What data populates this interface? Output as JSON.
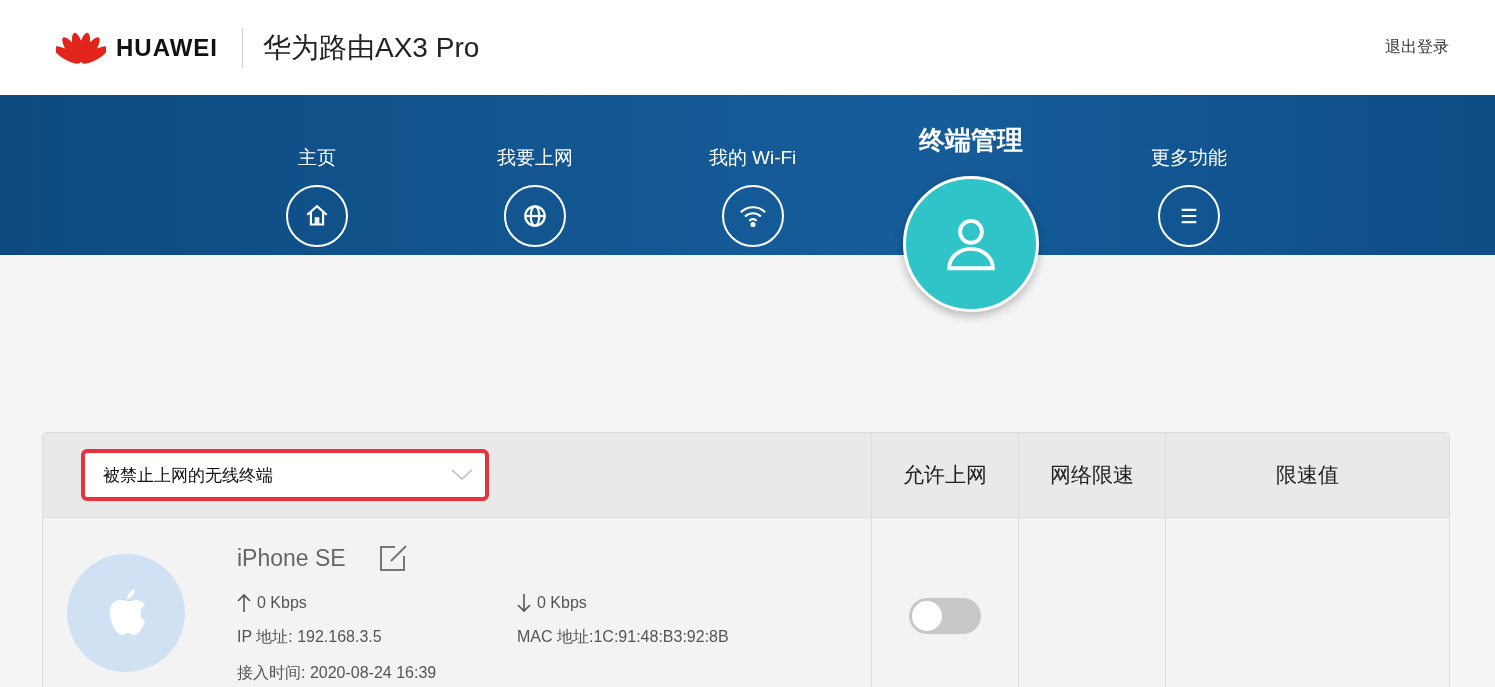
{
  "header": {
    "brand": "HUAWEI",
    "product": "华为路由AX3 Pro",
    "logout": "退出登录"
  },
  "nav": [
    {
      "label": "主页",
      "kind": "home",
      "selected": false
    },
    {
      "label": "我要上网",
      "kind": "globe",
      "selected": false
    },
    {
      "label": "我的 Wi-Fi",
      "kind": "wifi",
      "selected": false
    },
    {
      "label": "终端管理",
      "kind": "user",
      "selected": true
    },
    {
      "label": "更多功能",
      "kind": "menu",
      "selected": false
    }
  ],
  "table": {
    "filter": {
      "value": "被禁止上网的无线终端",
      "highlighted": true
    },
    "columns": [
      "允许上网",
      "网络限速",
      "限速值"
    ],
    "rows": [
      {
        "name": "iPhone SE",
        "upload": "0 Kbps",
        "download": "0 Kbps",
        "ip": "IP 地址: 192.168.3.5",
        "mac": "MAC 地址:1C:91:48:B3:92:8B",
        "connected": "接入时间: 2020-08-24 16:39",
        "allowed": false
      }
    ]
  }
}
